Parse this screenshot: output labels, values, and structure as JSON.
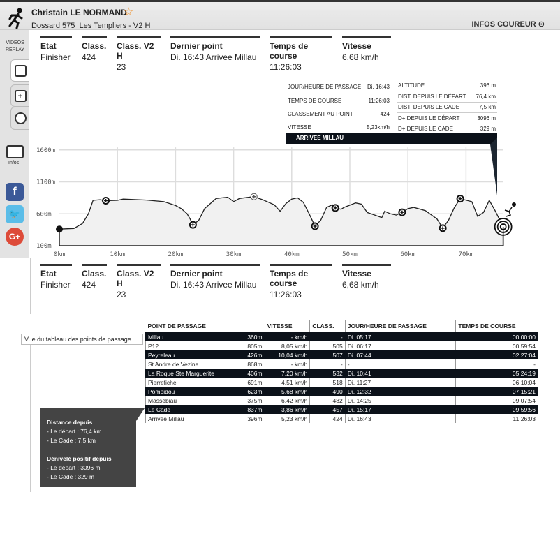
{
  "header": {
    "runner_name": "Christain LE NORMAND",
    "dossard": "Dossard 575",
    "race": "Les Templiers - V2 H",
    "infos_button": "INFOS COUREUR"
  },
  "sidebar": {
    "videos": "VIDEOS",
    "replay": "REPLAY",
    "infos": "Infos",
    "social": [
      "facebook",
      "twitter",
      "google-plus"
    ]
  },
  "stats": [
    {
      "label": "Etat",
      "value": "Finisher"
    },
    {
      "label": "Class.",
      "value": "424"
    },
    {
      "label": "Class. V2 H",
      "value": "23"
    },
    {
      "label": "Dernier point",
      "value": "Di. 16:43   Arrivee Millau"
    },
    {
      "label": "Temps de course",
      "value": "11:26:03"
    },
    {
      "label": "Vitesse",
      "value": "6,68 km/h"
    }
  ],
  "tooltip": {
    "title": "ARRIVEE MILLAU",
    "left": [
      [
        "JOUR/HEURE DE PASSAGE",
        "Di. 16:43"
      ],
      [
        "TEMPS DE COURSE",
        "11:26:03"
      ],
      [
        "CLASSEMENT AU POINT",
        "424"
      ],
      [
        "VITESSE",
        "5,23km/h"
      ]
    ],
    "right": [
      [
        "ALTITUDE",
        "396 m"
      ],
      [
        "DIST. DEPUIS LE DÉPART",
        "76,4 km"
      ],
      [
        "DIST. DEPUIS LE CADE",
        "7,5 km"
      ],
      [
        "D+ DEPUIS LE DÉPART",
        "3096 m"
      ],
      [
        "D+ DEPUIS LE CADE",
        "329 m"
      ]
    ]
  },
  "chart_data": {
    "type": "area",
    "xlim": [
      0,
      76.4
    ],
    "ylim": [
      100,
      1600
    ],
    "x_ticks": [
      "0km",
      "10km",
      "20km",
      "30km",
      "40km",
      "50km",
      "60km",
      "70km"
    ],
    "y_ticks": [
      "1600m",
      "1100m",
      "600m",
      "100m"
    ],
    "grid": true,
    "profile": [
      [
        0,
        360
      ],
      [
        2.5,
        370
      ],
      [
        4,
        450
      ],
      [
        5,
        600
      ],
      [
        5.8,
        810
      ],
      [
        7,
        820
      ],
      [
        8,
        805
      ],
      [
        10,
        810
      ],
      [
        11,
        830
      ],
      [
        15,
        815
      ],
      [
        18,
        790
      ],
      [
        20,
        730
      ],
      [
        21,
        680
      ],
      [
        22,
        600
      ],
      [
        22.5,
        520
      ],
      [
        23,
        426
      ],
      [
        24,
        500
      ],
      [
        25,
        680
      ],
      [
        26,
        760
      ],
      [
        27,
        840
      ],
      [
        29,
        860
      ],
      [
        30,
        790
      ],
      [
        31,
        840
      ],
      [
        33.5,
        868
      ],
      [
        35,
        820
      ],
      [
        37,
        740
      ],
      [
        38,
        640
      ],
      [
        39,
        760
      ],
      [
        40,
        830
      ],
      [
        41,
        850
      ],
      [
        42,
        780
      ],
      [
        43,
        600
      ],
      [
        44,
        406
      ],
      [
        45,
        500
      ],
      [
        46,
        700
      ],
      [
        47,
        740
      ],
      [
        47.5,
        691
      ],
      [
        48.5,
        670
      ],
      [
        49,
        700
      ],
      [
        51,
        770
      ],
      [
        52,
        750
      ],
      [
        53,
        620
      ],
      [
        54,
        590
      ],
      [
        55.5,
        540
      ],
      [
        56,
        640
      ],
      [
        57,
        600
      ],
      [
        58,
        580
      ],
      [
        59,
        623
      ],
      [
        60,
        680
      ],
      [
        61,
        700
      ],
      [
        63,
        650
      ],
      [
        65,
        520
      ],
      [
        66,
        375
      ],
      [
        67,
        500
      ],
      [
        68,
        700
      ],
      [
        69,
        837
      ],
      [
        71,
        790
      ],
      [
        72,
        560
      ],
      [
        73,
        620
      ],
      [
        74,
        810
      ],
      [
        75,
        650
      ],
      [
        76.4,
        396
      ]
    ],
    "checkpoints_km": [
      8,
      23,
      33.5,
      44,
      47.5,
      59,
      66,
      69
    ]
  },
  "table": {
    "headers": [
      "POINT DE PASSAGE",
      "VITESSE",
      "CLASS.",
      "JOUR/HEURE DE PASSAGE",
      "TEMPS DE COURSE"
    ],
    "rows": [
      [
        "Millau",
        "360m",
        "- km/h",
        "-",
        "Di. 05:17",
        "00:00:00"
      ],
      [
        "P12",
        "805m",
        "8,05 km/h",
        "505",
        "Di. 06:17",
        "00:59:54"
      ],
      [
        "Peyreleau",
        "426m",
        "10,04 km/h",
        "507",
        "Di. 07:44",
        "02:27:04"
      ],
      [
        "St Andre de Vezine",
        "868m",
        "- km/h",
        "-",
        "-",
        "-"
      ],
      [
        "La Roque Ste Marguerite",
        "406m",
        "7,20 km/h",
        "532",
        "Di. 10:41",
        "05:24:19"
      ],
      [
        "Pierrefiche",
        "691m",
        "4,51 km/h",
        "518",
        "Di. 11:27",
        "06:10:04"
      ],
      [
        "Pompidou",
        "623m",
        "5,68 km/h",
        "490",
        "Di. 12:32",
        "07:15:21"
      ],
      [
        "Massebiau",
        "375m",
        "6,42 km/h",
        "482",
        "Di. 14:25",
        "09:07:54"
      ],
      [
        "Le Cade",
        "837m",
        "3,86 km/h",
        "457",
        "Di. 15:17",
        "09:59:56"
      ],
      [
        "Arrivee Millau",
        "396m",
        "5,23 km/h",
        "424",
        "Di. 16:43",
        "11:26:03"
      ]
    ]
  },
  "vue_tableau": "Vue du tableau des points de passage",
  "dist_tip": {
    "t1": "Distance depuis",
    "l1": "- Le départ : 76,4 km",
    "l2": "- Le Cade : 7,5 km",
    "t2": "Dénivelé positif depuis",
    "l3": "- Le départ : 3096 m",
    "l4": "- Le Cade : 329 m"
  }
}
